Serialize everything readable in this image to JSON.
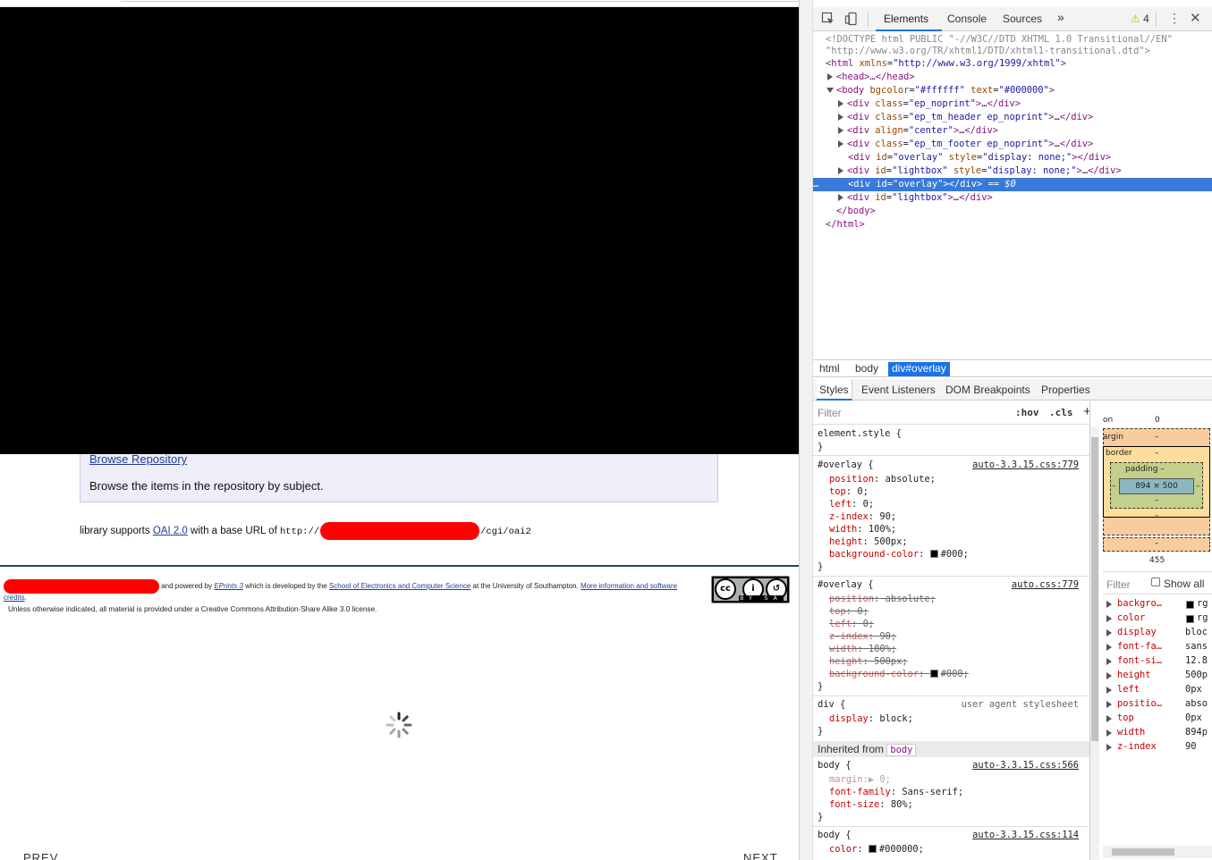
{
  "page": {
    "browse_link": "Browse Repository",
    "browse_desc": "Browse the items in the repository by subject.",
    "oai_prefix": "library supports",
    "oai_link": "OAI 2.0",
    "oai_middle": "with a base URL of",
    "oai_url_start": "http://",
    "oai_url_end": "/cgi/oai2",
    "footer_powered": "and powered by",
    "footer_eprints": "EPrints 3",
    "footer_developed": "which is developed by the",
    "footer_school": "School of Electronics and Computer Science",
    "footer_univ": "at the University of Southampton.",
    "footer_more": "More information and software credits",
    "footer_license": "Unless otherwise indicated, all material is provided under a Creative Commons Attribution-Share Alike 3.0 license.",
    "cc_label": "BY SA",
    "prev": "PREV",
    "next": "NEXT"
  },
  "devtools": {
    "tabs": {
      "elements": "Elements",
      "console": "Console",
      "sources": "Sources",
      "more": "»"
    },
    "warnings": "4",
    "dom": {
      "l1": "<!DOCTYPE html PUBLIC \"-//W3C//DTD XHTML 1.0 Transitional//EN\"",
      "l2": "\"http://www.w3.org/TR/xhtml1/DTD/xhtml1-transitional.dtd\">",
      "html_open": "<html",
      "xmlns_attr": "xmlns",
      "xmlns_val": "\"http://www.w3.org/1999/xhtml\"",
      "head": "<head>…</head>",
      "body_open": "<body",
      "bgcolor_attr": "bgcolor",
      "bgcolor_val": "\"#ffffff\"",
      "text_attr": "text",
      "text_val": "\"#000000\"",
      "div": "<div",
      "div_close": "</div>",
      "class_attr": "class",
      "ep_noprint": "\"ep_noprint\"",
      "ep_tm_header": "\"ep_tm_header ep_noprint\"",
      "align_attr": "align",
      "center_val": "\"center\"",
      "ep_tm_footer": "\"ep_tm_footer ep_noprint\"",
      "id_attr": "id",
      "overlay_val": "\"overlay\"",
      "lightbox_val": "\"lightbox\"",
      "style_attr": "style",
      "display_none": "\"display: none;\"",
      "ellipsis": "…",
      "eq_sel": "== $0",
      "body_close": "</body>",
      "html_close": "</html>",
      "dots": "…"
    },
    "breadcrumb": [
      "html",
      "body",
      "div#overlay"
    ],
    "subtabs": [
      "Styles",
      "Event Listeners",
      "DOM Breakpoints",
      "Properties"
    ],
    "filter_placeholder": "Filter",
    "hov": ":hov",
    "cls": ".cls",
    "plus": "+",
    "rules": {
      "element_style": "element.style {",
      "close": "}",
      "overlay_sel": "#overlay {",
      "src1": "auto-3.3.15.css:779",
      "src2": "auto.css:779",
      "src3": "user agent stylesheet",
      "src4": "auto-3.3.15.css:566",
      "src5": "auto-3.3.15.css:114",
      "div_sel": "div {",
      "body_sel": "body {",
      "props": {
        "position": "position",
        "position_v": "absolute;",
        "top": "top",
        "top_v": "0;",
        "left": "left",
        "left_v": "0;",
        "zindex": "z-index",
        "zindex_v": "90;",
        "width": "width",
        "width_v": "100%;",
        "height": "height",
        "height_v": "500px;",
        "bg": "background-color",
        "bg_v": "#000;",
        "display": "display",
        "display_v": "block;",
        "margin": "margin",
        "margin_v": "0;",
        "ff": "font-family",
        "ff_v": "Sans-serif;",
        "fs": "font-size",
        "fs_v": "80%;",
        "color": "color",
        "color_v": "#000000;",
        "colon": ":"
      }
    },
    "inherited_label": "Inherited from",
    "inherited_chip": "body",
    "boxmodel": {
      "position_lbl": "on",
      "position_val": "0",
      "margin_lbl": "argin",
      "dash": "–",
      "border_lbl": "border",
      "padding_lbl": "padding –",
      "content": "894 × 500",
      "bottom_val": "455"
    },
    "computed_filter": "Filter",
    "show_all": "Show all",
    "computed": [
      {
        "p": "backgro…",
        "v": "rg"
      },
      {
        "p": "color",
        "v": "rg"
      },
      {
        "p": "display",
        "v": "bloc"
      },
      {
        "p": "font-fa…",
        "v": "sans"
      },
      {
        "p": "font-si…",
        "v": "12.8"
      },
      {
        "p": "height",
        "v": "500p"
      },
      {
        "p": "left",
        "v": "0px"
      },
      {
        "p": "positio…",
        "v": "abso"
      },
      {
        "p": "top",
        "v": "0px"
      },
      {
        "p": "width",
        "v": "894p"
      },
      {
        "p": "z-index",
        "v": "90"
      }
    ]
  }
}
